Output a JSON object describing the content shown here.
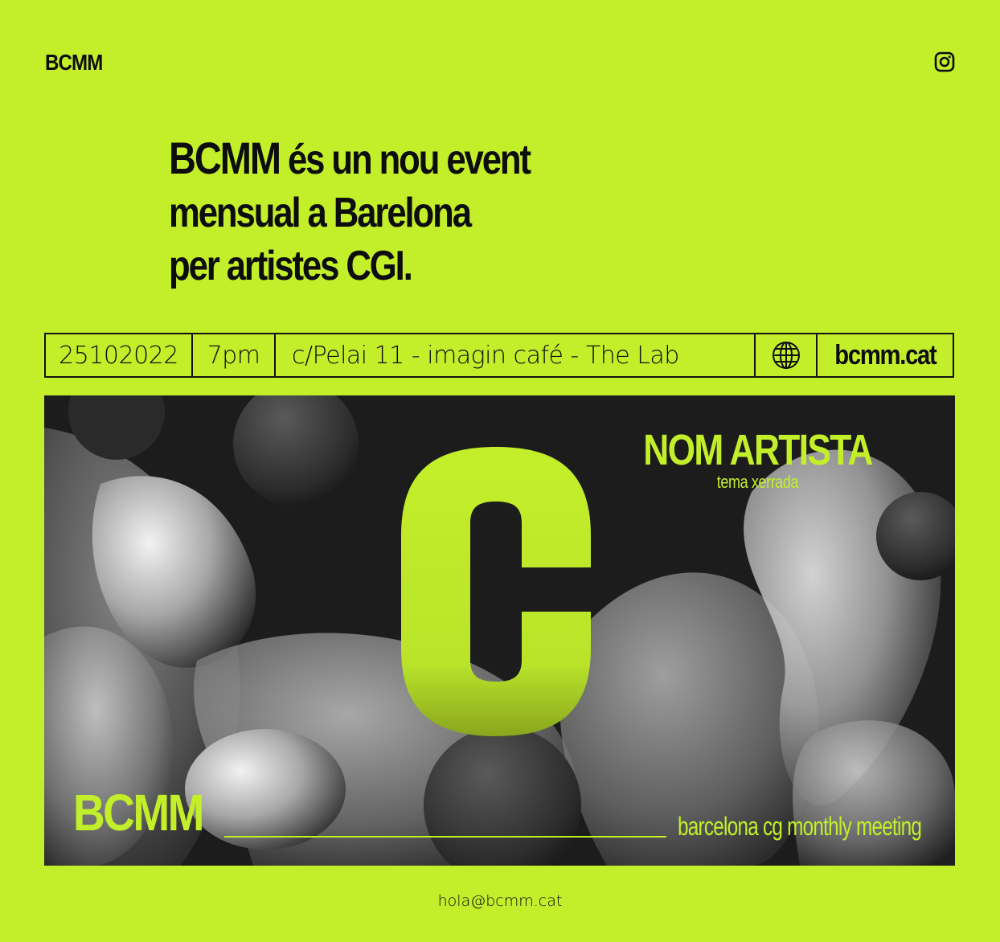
{
  "header": {
    "logo": "BCMM",
    "social_icon": "instagram-icon"
  },
  "headline": {
    "brand": "BCMM",
    "line1_rest": "és un nou event",
    "line2": "mensual a Barelona",
    "line3": "per artistes CGI."
  },
  "event_bar": {
    "date": "25102022",
    "time": "7pm",
    "location": "c/Pelai 11 - imagin café - The Lab",
    "globe_icon": "globe-icon",
    "website": "bcmm.cat"
  },
  "poster": {
    "letter": "C",
    "artist_name": "NOM ARTISTA",
    "talk_topic": "tema xerrada",
    "brand": "BCMM",
    "tagline": "barcelona cg monthly meeting"
  },
  "colors": {
    "accent": "#c3ef2a",
    "ink": "#0d0d0d"
  },
  "footer": {
    "email": "hola@bcmm.cat"
  }
}
